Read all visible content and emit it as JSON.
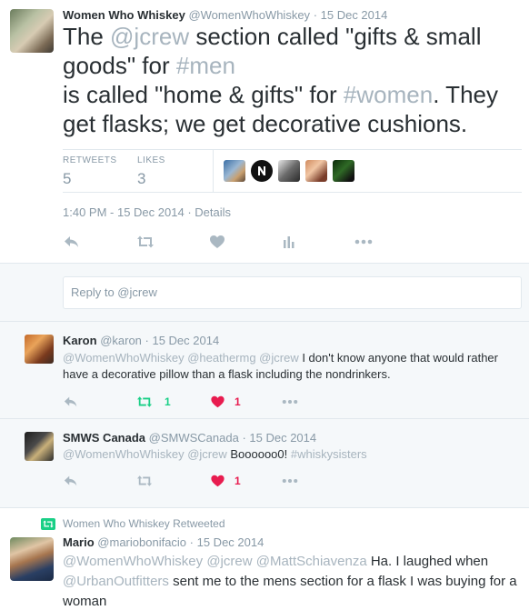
{
  "main_tweet": {
    "author_name": "Women Who Whiskey",
    "author_handle": "@WomenWhoWhiskey",
    "date": "· 15 Dec 2014",
    "text_parts": [
      "The ",
      "@jcrew",
      " section called \"gifts & small goods\" for ",
      "#men",
      " is called \"home & gifts\" for ",
      "#women",
      ". They get flasks; we get decorative cushions."
    ],
    "retweets_label": "RETWEETS",
    "retweets_count": "5",
    "likes_label": "LIKES",
    "likes_count": "3",
    "timestamp": "1:40 PM - 15 Dec 2014",
    "details_link": "· Details"
  },
  "reply_box": {
    "placeholder": "Reply to @jcrew"
  },
  "replies": [
    {
      "author_name": "Karon",
      "author_handle": "@karon",
      "date": "· 15 Dec 2014",
      "mentions": "@WomenWhoWhiskey @heathermg @jcrew",
      "text": " I don't know anyone that would rather have a decorative pillow than a flask including the nondrinkers.",
      "retweet_count": "1",
      "like_count": "1"
    },
    {
      "author_name": "SMWS Canada",
      "author_handle": "@SMWSCanada",
      "date": "· 15 Dec 2014",
      "mentions": "@WomenWhoWhiskey @jcrew",
      "text": " Boooooo0! ",
      "hashtag": "#whiskysisters",
      "like_count": "1"
    }
  ],
  "retweeted": {
    "context": "Women Who Whiskey Retweeted",
    "author_name": "Mario",
    "author_handle": "@mariobonifacio",
    "date": "· 15 Dec 2014",
    "mentions_1": "@WomenWhoWhiskey @jcrew @MattSchiavenza",
    "text_1": " Ha. I laughed when ",
    "mentions_2": "@UrbanOutfitters",
    "text_2": " sent me to the mens section for a flask I was buying for a woman"
  },
  "colors": {
    "retweet_green": "#19cf86",
    "like_red": "#e81c4f",
    "link_gray": "#a7b4be",
    "muted": "#8899a6"
  },
  "icons": [
    "reply-icon",
    "retweet-icon",
    "like-icon",
    "analytics-icon",
    "more-icon"
  ]
}
